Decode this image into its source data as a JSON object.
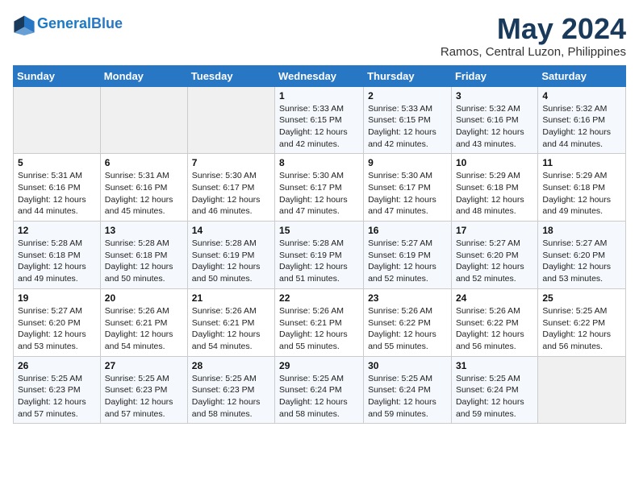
{
  "header": {
    "logo_line1": "General",
    "logo_line2": "Blue",
    "title": "May 2024",
    "subtitle": "Ramos, Central Luzon, Philippines"
  },
  "weekdays": [
    "Sunday",
    "Monday",
    "Tuesday",
    "Wednesday",
    "Thursday",
    "Friday",
    "Saturday"
  ],
  "weeks": [
    [
      {
        "day": "",
        "sunrise": "",
        "sunset": "",
        "daylight": ""
      },
      {
        "day": "",
        "sunrise": "",
        "sunset": "",
        "daylight": ""
      },
      {
        "day": "",
        "sunrise": "",
        "sunset": "",
        "daylight": ""
      },
      {
        "day": "1",
        "sunrise": "Sunrise: 5:33 AM",
        "sunset": "Sunset: 6:15 PM",
        "daylight": "Daylight: 12 hours and 42 minutes."
      },
      {
        "day": "2",
        "sunrise": "Sunrise: 5:33 AM",
        "sunset": "Sunset: 6:15 PM",
        "daylight": "Daylight: 12 hours and 42 minutes."
      },
      {
        "day": "3",
        "sunrise": "Sunrise: 5:32 AM",
        "sunset": "Sunset: 6:16 PM",
        "daylight": "Daylight: 12 hours and 43 minutes."
      },
      {
        "day": "4",
        "sunrise": "Sunrise: 5:32 AM",
        "sunset": "Sunset: 6:16 PM",
        "daylight": "Daylight: 12 hours and 44 minutes."
      }
    ],
    [
      {
        "day": "5",
        "sunrise": "Sunrise: 5:31 AM",
        "sunset": "Sunset: 6:16 PM",
        "daylight": "Daylight: 12 hours and 44 minutes."
      },
      {
        "day": "6",
        "sunrise": "Sunrise: 5:31 AM",
        "sunset": "Sunset: 6:16 PM",
        "daylight": "Daylight: 12 hours and 45 minutes."
      },
      {
        "day": "7",
        "sunrise": "Sunrise: 5:30 AM",
        "sunset": "Sunset: 6:17 PM",
        "daylight": "Daylight: 12 hours and 46 minutes."
      },
      {
        "day": "8",
        "sunrise": "Sunrise: 5:30 AM",
        "sunset": "Sunset: 6:17 PM",
        "daylight": "Daylight: 12 hours and 47 minutes."
      },
      {
        "day": "9",
        "sunrise": "Sunrise: 5:30 AM",
        "sunset": "Sunset: 6:17 PM",
        "daylight": "Daylight: 12 hours and 47 minutes."
      },
      {
        "day": "10",
        "sunrise": "Sunrise: 5:29 AM",
        "sunset": "Sunset: 6:18 PM",
        "daylight": "Daylight: 12 hours and 48 minutes."
      },
      {
        "day": "11",
        "sunrise": "Sunrise: 5:29 AM",
        "sunset": "Sunset: 6:18 PM",
        "daylight": "Daylight: 12 hours and 49 minutes."
      }
    ],
    [
      {
        "day": "12",
        "sunrise": "Sunrise: 5:28 AM",
        "sunset": "Sunset: 6:18 PM",
        "daylight": "Daylight: 12 hours and 49 minutes."
      },
      {
        "day": "13",
        "sunrise": "Sunrise: 5:28 AM",
        "sunset": "Sunset: 6:18 PM",
        "daylight": "Daylight: 12 hours and 50 minutes."
      },
      {
        "day": "14",
        "sunrise": "Sunrise: 5:28 AM",
        "sunset": "Sunset: 6:19 PM",
        "daylight": "Daylight: 12 hours and 50 minutes."
      },
      {
        "day": "15",
        "sunrise": "Sunrise: 5:28 AM",
        "sunset": "Sunset: 6:19 PM",
        "daylight": "Daylight: 12 hours and 51 minutes."
      },
      {
        "day": "16",
        "sunrise": "Sunrise: 5:27 AM",
        "sunset": "Sunset: 6:19 PM",
        "daylight": "Daylight: 12 hours and 52 minutes."
      },
      {
        "day": "17",
        "sunrise": "Sunrise: 5:27 AM",
        "sunset": "Sunset: 6:20 PM",
        "daylight": "Daylight: 12 hours and 52 minutes."
      },
      {
        "day": "18",
        "sunrise": "Sunrise: 5:27 AM",
        "sunset": "Sunset: 6:20 PM",
        "daylight": "Daylight: 12 hours and 53 minutes."
      }
    ],
    [
      {
        "day": "19",
        "sunrise": "Sunrise: 5:27 AM",
        "sunset": "Sunset: 6:20 PM",
        "daylight": "Daylight: 12 hours and 53 minutes."
      },
      {
        "day": "20",
        "sunrise": "Sunrise: 5:26 AM",
        "sunset": "Sunset: 6:21 PM",
        "daylight": "Daylight: 12 hours and 54 minutes."
      },
      {
        "day": "21",
        "sunrise": "Sunrise: 5:26 AM",
        "sunset": "Sunset: 6:21 PM",
        "daylight": "Daylight: 12 hours and 54 minutes."
      },
      {
        "day": "22",
        "sunrise": "Sunrise: 5:26 AM",
        "sunset": "Sunset: 6:21 PM",
        "daylight": "Daylight: 12 hours and 55 minutes."
      },
      {
        "day": "23",
        "sunrise": "Sunrise: 5:26 AM",
        "sunset": "Sunset: 6:22 PM",
        "daylight": "Daylight: 12 hours and 55 minutes."
      },
      {
        "day": "24",
        "sunrise": "Sunrise: 5:26 AM",
        "sunset": "Sunset: 6:22 PM",
        "daylight": "Daylight: 12 hours and 56 minutes."
      },
      {
        "day": "25",
        "sunrise": "Sunrise: 5:25 AM",
        "sunset": "Sunset: 6:22 PM",
        "daylight": "Daylight: 12 hours and 56 minutes."
      }
    ],
    [
      {
        "day": "26",
        "sunrise": "Sunrise: 5:25 AM",
        "sunset": "Sunset: 6:23 PM",
        "daylight": "Daylight: 12 hours and 57 minutes."
      },
      {
        "day": "27",
        "sunrise": "Sunrise: 5:25 AM",
        "sunset": "Sunset: 6:23 PM",
        "daylight": "Daylight: 12 hours and 57 minutes."
      },
      {
        "day": "28",
        "sunrise": "Sunrise: 5:25 AM",
        "sunset": "Sunset: 6:23 PM",
        "daylight": "Daylight: 12 hours and 58 minutes."
      },
      {
        "day": "29",
        "sunrise": "Sunrise: 5:25 AM",
        "sunset": "Sunset: 6:24 PM",
        "daylight": "Daylight: 12 hours and 58 minutes."
      },
      {
        "day": "30",
        "sunrise": "Sunrise: 5:25 AM",
        "sunset": "Sunset: 6:24 PM",
        "daylight": "Daylight: 12 hours and 59 minutes."
      },
      {
        "day": "31",
        "sunrise": "Sunrise: 5:25 AM",
        "sunset": "Sunset: 6:24 PM",
        "daylight": "Daylight: 12 hours and 59 minutes."
      },
      {
        "day": "",
        "sunrise": "",
        "sunset": "",
        "daylight": ""
      }
    ]
  ]
}
